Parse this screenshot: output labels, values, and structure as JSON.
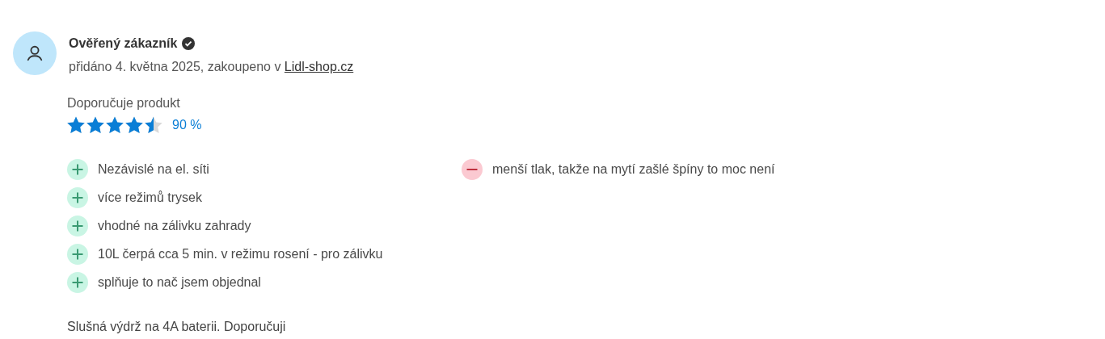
{
  "review": {
    "author": "Ověřený zákazník",
    "verified": true,
    "meta": "přidáno 4. května 2025, zakoupeno v ",
    "shop_link": "Lidl-shop.cz",
    "recommend_label": "Doporučuje produkt",
    "stars": 4.5,
    "percent": "90 %",
    "pros": [
      "Nezávislé na el. síti",
      "více režimů trysek",
      "vhodné na zálivku zahrady",
      "10L čerpá cca 5 min. v režimu rosení - pro zálivku",
      "splňuje to nač jsem objednal"
    ],
    "cons": [
      "menší tlak, takže na mytí zašlé špíny to moc není"
    ],
    "text": "Slušná výdrž na 4A baterii. Doporučuji"
  }
}
